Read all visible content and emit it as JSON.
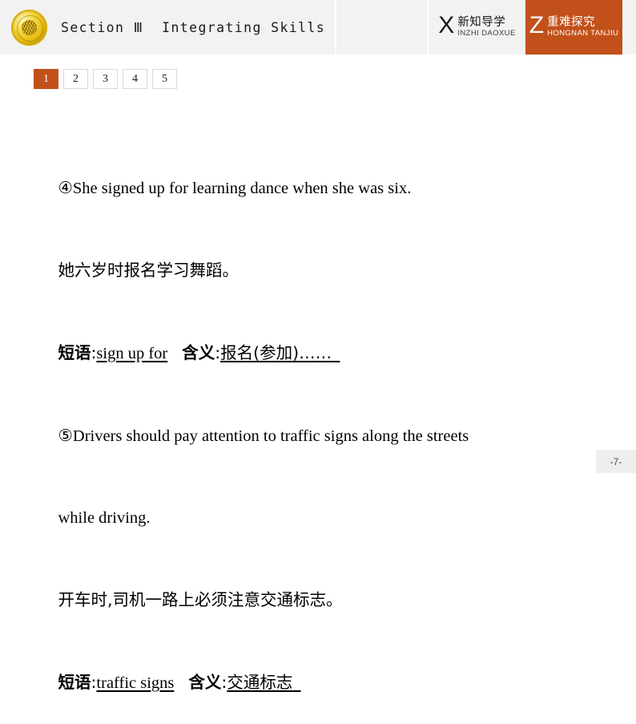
{
  "header": {
    "logo_icon": "gold-emblem-icon",
    "section_title": "Section Ⅲ  Integrating Skills",
    "tabs": [
      {
        "letter": "X",
        "cn": "新知导学",
        "pinyin": "INZHI DAOXUE",
        "active": false
      },
      {
        "letter": "Z",
        "cn": "重难探究",
        "pinyin": "HONGNAN TANJIU",
        "active": true
      }
    ]
  },
  "pager": {
    "items": [
      "1",
      "2",
      "3",
      "4",
      "5"
    ],
    "active_index": 0
  },
  "content": {
    "item4": {
      "marker": "④",
      "english": "She signed up for learning dance when she was six.",
      "chinese": "她六岁时报名学习舞蹈。",
      "phrase_label": "短语",
      "phrase_value": "sign up for",
      "meaning_label": "含义",
      "meaning_value": "报名(参加)……"
    },
    "item5": {
      "marker": "⑤",
      "english_line1": "Drivers should pay attention to traffic signs along the streets",
      "english_line2": "while driving.",
      "chinese": "开车时,司机一路上必须注意交通标志。",
      "phrase_label": "短语",
      "phrase_value": "traffic signs",
      "meaning_label": "含义",
      "meaning_value": "交通标志"
    }
  },
  "footer": {
    "page_number": "-7-"
  },
  "colors": {
    "accent": "#c2501a",
    "header_bg": "#f2f2f2",
    "page_badge_bg": "#eeeeee"
  }
}
